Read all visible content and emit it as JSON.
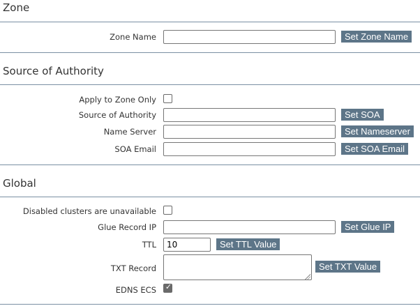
{
  "zone": {
    "title": "Zone",
    "zone_name_label": "Zone Name",
    "zone_name_value": "",
    "set_zone_name_button": "Set Zone Name"
  },
  "soa": {
    "title": "Source of Authority",
    "apply_zone_only_label": "Apply to Zone Only",
    "apply_zone_only_checked": false,
    "soa_label": "Source of Authority",
    "soa_value": "",
    "set_soa_button": "Set SOA",
    "name_server_label": "Name Server",
    "name_server_value": "",
    "set_nameserver_button": "Set Nameserver",
    "soa_email_label": "SOA Email",
    "soa_email_value": "",
    "set_soa_email_button": "Set SOA Email"
  },
  "global": {
    "title": "Global",
    "disabled_clusters_label": "Disabled clusters are unavailable",
    "disabled_clusters_checked": false,
    "glue_record_label": "Glue Record IP",
    "glue_record_value": "",
    "set_glue_ip_button": "Set Glue IP",
    "ttl_label": "TTL",
    "ttl_value": "10",
    "set_ttl_button": "Set TTL Value",
    "txt_record_label": "TXT Record",
    "txt_record_value": "",
    "set_txt_button": "Set TXT Value",
    "edns_ecs_label": "EDNS ECS",
    "edns_ecs_checked": true,
    "check_mark": "✓"
  }
}
